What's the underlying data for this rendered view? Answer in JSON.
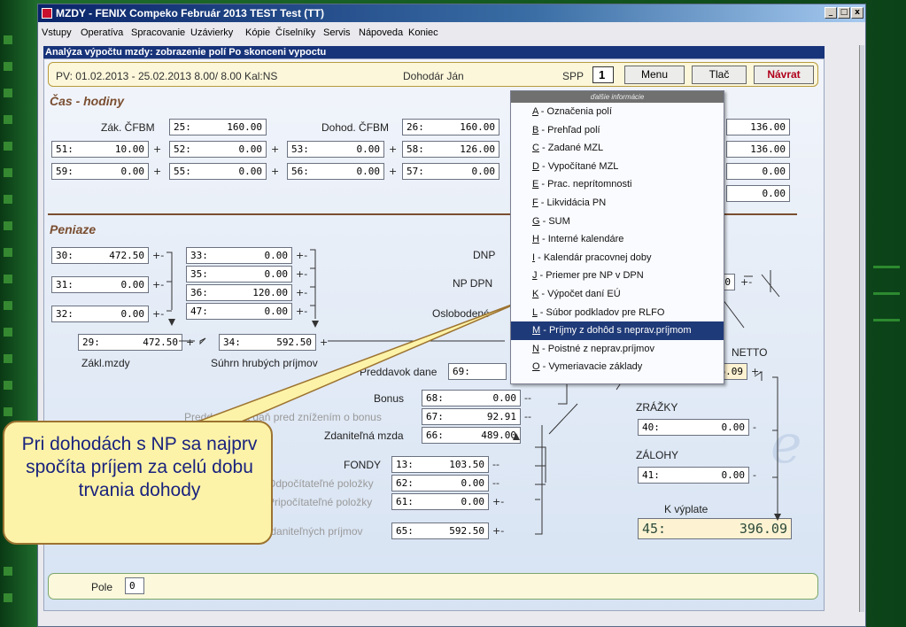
{
  "window": {
    "title": "MZDY - FENIX Compeko  Február 2013   TEST Test  (TT)",
    "controls": {
      "minimize": "_",
      "maximize": "□",
      "close": "x"
    }
  },
  "menubar": [
    "Vstupy",
    "Operatíva",
    "Spracovanie",
    "Uzávierky",
    "Kópie",
    "Číselníky",
    "Servis",
    "Nápoveda",
    "Koniec"
  ],
  "subtitle": "Analýza výpočtu mzdy: zobrazenie polí Po skonceni vypoctu",
  "info": {
    "pv": "PV: 01.02.2013 - 25.02.2013   8.00/ 8.00  Kal:NS",
    "employee": "Dohodár Ján",
    "spp_label": "SPP",
    "spp_value": "1",
    "menu_button": "Menu",
    "print_button": "Tlač",
    "back_button": "Návrat"
  },
  "cas": {
    "heading": "Čas - hodiny",
    "zak_label": "Zák. ČFBM",
    "dohod_label": "Dohod. ČFBM",
    "fields": {
      "f25": {
        "code": "25:",
        "value": "160.00"
      },
      "f26": {
        "code": "26:",
        "value": "160.00"
      },
      "f51": {
        "code": "51:",
        "value": "10.00"
      },
      "f52": {
        "code": "52:",
        "value": "0.00"
      },
      "f53": {
        "code": "53:",
        "value": "0.00"
      },
      "f58": {
        "code": "58:",
        "value": "126.00"
      },
      "f59": {
        "code": "59:",
        "value": "0.00"
      },
      "f55": {
        "code": "55:",
        "value": "0.00"
      },
      "f56": {
        "code": "56:",
        "value": "0.00"
      },
      "f57": {
        "code": "57:",
        "value": "0.00"
      },
      "r1": {
        "value": "136.00"
      },
      "r2": {
        "value": "136.00"
      },
      "r3": {
        "value": "0.00"
      },
      "r4": {
        "value": "0.00"
      }
    },
    "plus": "+"
  },
  "peniaze": {
    "heading": "Peniaze",
    "fields": {
      "f30": {
        "code": "30:",
        "value": "472.50"
      },
      "f31": {
        "code": "31:",
        "value": "0.00"
      },
      "f32": {
        "code": "32:",
        "value": "0.00"
      },
      "f33": {
        "code": "33:",
        "value": "0.00"
      },
      "f35": {
        "code": "35:",
        "value": "0.00"
      },
      "f36": {
        "code": "36:",
        "value": "120.00"
      },
      "f47": {
        "code": "47:",
        "value": "0.00"
      },
      "f29": {
        "code": "29:",
        "value": "472.50"
      },
      "f34": {
        "code": "34:",
        "value": "592.50"
      },
      "f69": {
        "code": "69:",
        "value": ""
      },
      "f68": {
        "code": "68:",
        "value": "0.00"
      },
      "f67": {
        "code": "67:",
        "value": "92.91"
      },
      "f66": {
        "code": "66:",
        "value": "489.00"
      },
      "f13": {
        "code": "13:",
        "value": "103.50"
      },
      "f62": {
        "code": "62:",
        "value": "0.00"
      },
      "f61": {
        "code": "61:",
        "value": "0.00"
      },
      "f65": {
        "code": "65:",
        "value": "592.50"
      },
      "f40": {
        "code": "40:",
        "value": "0.00"
      },
      "f41": {
        "code": "41:",
        "value": "0.00"
      },
      "f45": {
        "code": "45:",
        "value": "396.09"
      },
      "netto_partial": {
        "value": "6.09"
      },
      "npdpn_partial": {
        "value": "00"
      }
    },
    "labels": {
      "dnp": "DNP",
      "npdpn": "NP DPN",
      "oslobodene": "Oslobodené",
      "zakl_mzdy": "Zákl.mzdy",
      "suhrn": "Súhrn hrubých príjmov",
      "preddavok_dane": "Preddavok dane",
      "bonus": "Bonus",
      "preddavok_bonus": "Preddavok na daň pred znížením o bonus",
      "zdanitelna": "Zdaniteľná mzda",
      "fondy": "FONDY",
      "odpocitatelne": "Odpočítateľné položky",
      "pripocitatelne": "Pripočítateľné položky",
      "uhrn": "Úhrn zdaniteľných príjmov",
      "netto": "NETTO",
      "zrazky": "ZRÁŽKY",
      "zalohy": "ZÁLOHY",
      "k_vyplate": "K výplate"
    },
    "ops": {
      "plus": "+",
      "minus": "-",
      "pm": "+-",
      "mm": "--"
    }
  },
  "bottom": {
    "pole_label": "Pole",
    "pole_value": "0"
  },
  "dropdown": {
    "header": "ďalšie informácie",
    "items": [
      {
        "key": "A",
        "label": " - Označenia polí"
      },
      {
        "key": "B",
        "label": " - Prehľad polí"
      },
      {
        "key": "C",
        "label": " - Zadané MZL"
      },
      {
        "key": "D",
        "label": " - Vypočítané MZL"
      },
      {
        "key": "E",
        "label": " - Prac. neprítomnosti"
      },
      {
        "key": "F",
        "label": " - Likvidácia PN"
      },
      {
        "key": "G",
        "label": " - SUM"
      },
      {
        "key": "H",
        "label": " - Interné kalendáre"
      },
      {
        "key": "I",
        "label": " - Kalendár pracovnej doby"
      },
      {
        "key": "J",
        "label": " - Priemer pre NP v DPN"
      },
      {
        "key": "K",
        "label": " - Výpočet daní EÚ"
      },
      {
        "key": "L",
        "label": " - Súbor podkladov pre RLFO"
      },
      {
        "key": "M",
        "label": " - Príjmy z dohôd s neprav.príjmom"
      },
      {
        "key": "N",
        "label": " - Poistné z neprav.príjmov"
      },
      {
        "key": "O",
        "label": " - Vymeriavacie základy"
      }
    ],
    "selected_index": 12
  },
  "callout": {
    "text": "Pri dohodách s NP sa najprv spočíta príjem za celú dobu trvania dohody"
  },
  "colors": {
    "accent_red": "#c8102e",
    "selection": "#1f3a78",
    "section": "#7a4e31",
    "callout_bg": "#fdf3a8"
  }
}
